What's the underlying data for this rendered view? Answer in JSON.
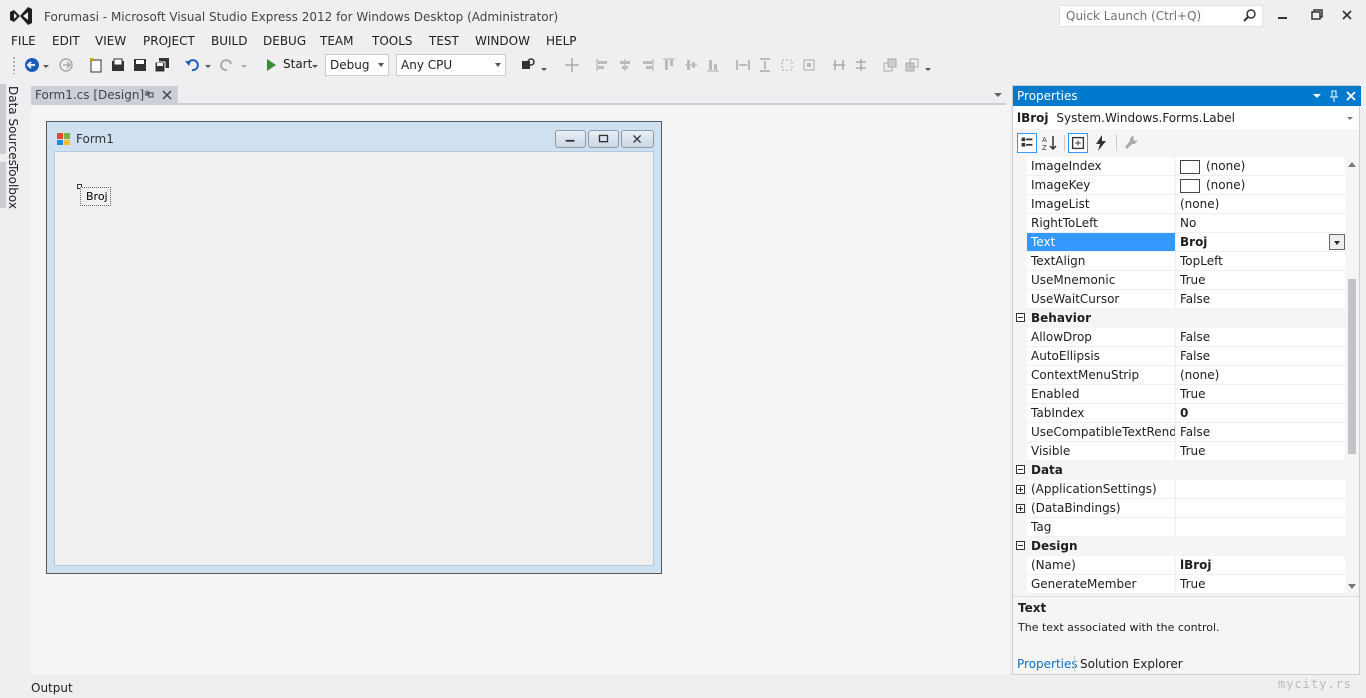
{
  "window": {
    "title": "Forumasi - Microsoft Visual Studio Express 2012 for Windows Desktop (Administrator)",
    "quick_launch_placeholder": "Quick Launch (Ctrl+Q)"
  },
  "menu": [
    "FILE",
    "EDIT",
    "VIEW",
    "PROJECT",
    "BUILD",
    "DEBUG",
    "TEAM",
    "TOOLS",
    "TEST",
    "WINDOW",
    "HELP"
  ],
  "toolbar": {
    "start_label": "Start",
    "config": "Debug",
    "platform": "Any CPU"
  },
  "side_tabs": [
    "Data Sources",
    "Toolbox"
  ],
  "document_tab": "Form1.cs [Design]*",
  "form": {
    "title": "Form1",
    "label_text": "Broj"
  },
  "output_label": "Output",
  "properties": {
    "header": "Properties",
    "object_name": "lBroj",
    "object_type": "System.Windows.Forms.Label",
    "rows": [
      {
        "kind": "prop",
        "name": "ImageIndex",
        "value": "(none)",
        "swatch": true
      },
      {
        "kind": "prop",
        "name": "ImageKey",
        "value": "(none)",
        "swatch": true
      },
      {
        "kind": "prop",
        "name": "ImageList",
        "value": "(none)"
      },
      {
        "kind": "prop",
        "name": "RightToLeft",
        "value": "No"
      },
      {
        "kind": "prop",
        "name": "Text",
        "value": "Broj",
        "selected": true,
        "bold": true,
        "dropdown": true
      },
      {
        "kind": "prop",
        "name": "TextAlign",
        "value": "TopLeft"
      },
      {
        "kind": "prop",
        "name": "UseMnemonic",
        "value": "True"
      },
      {
        "kind": "prop",
        "name": "UseWaitCursor",
        "value": "False"
      },
      {
        "kind": "cat",
        "name": "Behavior"
      },
      {
        "kind": "prop",
        "name": "AllowDrop",
        "value": "False"
      },
      {
        "kind": "prop",
        "name": "AutoEllipsis",
        "value": "False"
      },
      {
        "kind": "prop",
        "name": "ContextMenuStrip",
        "value": "(none)"
      },
      {
        "kind": "prop",
        "name": "Enabled",
        "value": "True"
      },
      {
        "kind": "prop",
        "name": "TabIndex",
        "value": "0",
        "bold": true
      },
      {
        "kind": "prop",
        "name": "UseCompatibleTextRenderi",
        "value": "False"
      },
      {
        "kind": "prop",
        "name": "Visible",
        "value": "True"
      },
      {
        "kind": "cat",
        "name": "Data"
      },
      {
        "kind": "prop",
        "name": "(ApplicationSettings)",
        "value": "",
        "expand": true
      },
      {
        "kind": "prop",
        "name": "(DataBindings)",
        "value": "",
        "expand": true
      },
      {
        "kind": "prop",
        "name": "Tag",
        "value": ""
      },
      {
        "kind": "cat",
        "name": "Design"
      },
      {
        "kind": "prop",
        "name": "(Name)",
        "value": "lBroj",
        "bold": true
      },
      {
        "kind": "prop",
        "name": "GenerateMember",
        "value": "True"
      }
    ],
    "description_title": "Text",
    "description_text": "The text associated with the control."
  },
  "bottom_tabs": [
    "Properties",
    "Solution Explorer"
  ],
  "watermark": "mycity.rs",
  "colors": {
    "accent": "#007acc",
    "selection": "#3399ff",
    "vs_purple": "#68217a"
  }
}
